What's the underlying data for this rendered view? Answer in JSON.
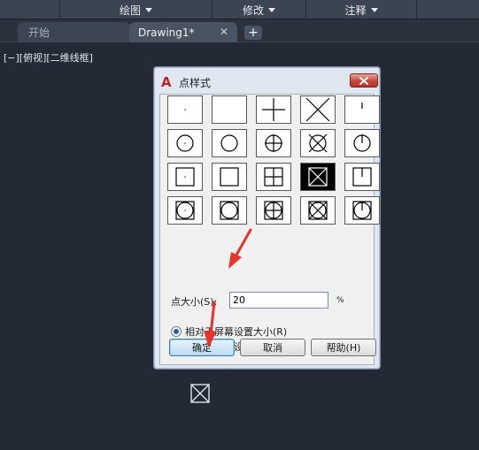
{
  "menubar": {
    "items": [
      {
        "label": "",
        "has_caret": false
      },
      {
        "label": "绘图",
        "has_caret": true
      },
      {
        "label": "修改",
        "has_caret": true
      },
      {
        "label": "注释",
        "has_caret": true
      },
      {
        "label": "",
        "has_caret": false
      }
    ]
  },
  "tabs": {
    "start_label": "开始",
    "drawing_label": "Drawing1*",
    "close_glyph": "✕",
    "add_glyph": "+"
  },
  "viewport": {
    "label": "[−][俯视][二维线框]"
  },
  "dialog": {
    "title": "点样式",
    "logo_letter": "A",
    "selected_style_index": 13,
    "point_styles": [
      "dot",
      "blank",
      "plus",
      "cross",
      "tick",
      "circle-dot",
      "circle",
      "circle-plus",
      "circle-cross",
      "circle-tick",
      "square-dot",
      "square",
      "square-plus",
      "square-cross",
      "square-tick",
      "squarecircle-dot",
      "squarecircle",
      "squarecircle-plus",
      "squarecircle-cross",
      "squarecircle-tick"
    ],
    "size_label": "点大小(S):",
    "size_value": "20",
    "size_unit": "%",
    "radio_relative_label": "相对于屏幕设置大小(R)",
    "radio_absolute_label": "按绝对单位设置大小(A)",
    "radio_selected": "relative",
    "ok_label": "确定",
    "cancel_label": "取消",
    "help_label": "帮助(H)"
  },
  "colors": {
    "canvas_bg": "#232a35",
    "annotation_arrow": "#e8322a",
    "close_button": "#c5473a",
    "accent_radio": "#1f5fb0"
  }
}
